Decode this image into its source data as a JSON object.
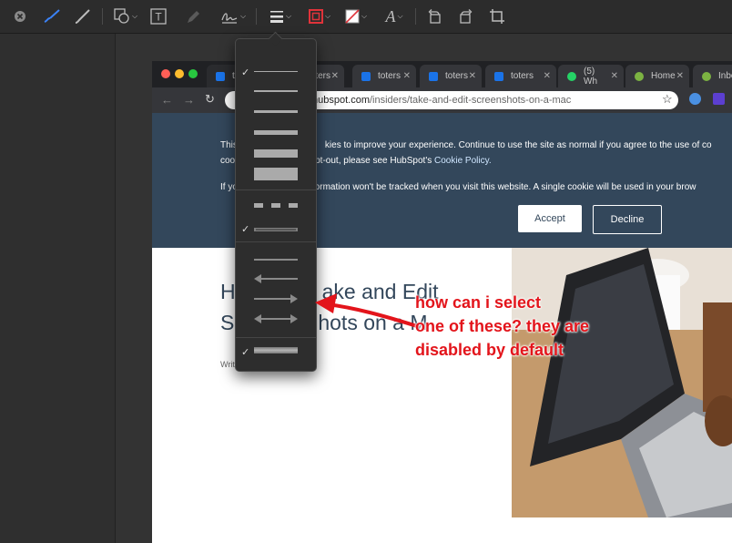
{
  "toolbar": {
    "icons": [
      "close-icon",
      "sketch-icon",
      "draw-icon",
      "shapes-icon",
      "text-icon",
      "highlight-icon",
      "sign-icon",
      "line-style-icon",
      "border-color-icon",
      "fill-color-icon",
      "font-icon",
      "rotate-left-icon",
      "rotate-right-icon",
      "crop-icon"
    ],
    "text_tool_label": "T",
    "font_tool_label": "A"
  },
  "browser": {
    "tabs": [
      {
        "label": "toters",
        "favicon_color": "#1a73e8"
      },
      {
        "label": "toters",
        "favicon_color": "#1a73e8"
      },
      {
        "label": "toters",
        "favicon_color": "#1a73e8"
      },
      {
        "label": "toters",
        "favicon_color": "#1a73e8"
      },
      {
        "label": "(5) Wh",
        "favicon_color": "#25d366"
      },
      {
        "label": "Home",
        "favicon_color": "#7cb342"
      },
      {
        "label": "Inbo",
        "favicon_color": "#7cb342"
      }
    ],
    "url_prefix": "hubspot.com",
    "url_path": "/insiders/take-and-edit-screenshots-on-a-mac"
  },
  "cookie_banner": {
    "line1_a": "This",
    "line1_b": "kies to improve your experience. Continue to use the site as normal if you agree to the use of co",
    "line2_a": "coo",
    "line2_b": "pt-out, please see HubSpot's",
    "link": "Cookie Policy.",
    "line3_a": "If yo",
    "line3_b": "formation won't be tracked when you visit this website. A single cookie will be used in your brow",
    "accept_label": "Accept",
    "decline_label": "Decline"
  },
  "article": {
    "title_line1_a": "H",
    "title_line1_b": "ake and Edit",
    "title_line2_a": "S",
    "title_line2_b": "hots on a M",
    "byline": "Writ"
  },
  "annotation": {
    "lines": [
      "how can i select",
      "one of these? they are",
      "disabled by default"
    ],
    "color": "#e3141b"
  },
  "menu": {
    "checkmark": "✓"
  }
}
